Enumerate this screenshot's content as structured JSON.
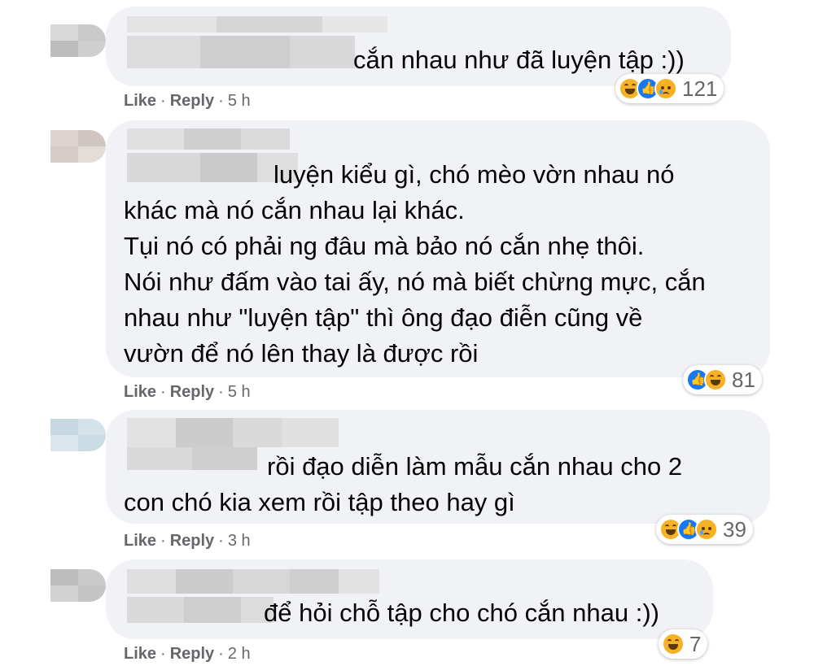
{
  "comments": [
    {
      "text": "cắn nhau như đã luyện tập :))",
      "reactions": {
        "icons": [
          "haha-icon",
          "like-icon",
          "sad-icon"
        ],
        "count": "121"
      },
      "like_label": "Like",
      "reply_label": "Reply",
      "time": "5 h"
    },
    {
      "text": "luyện kiểu gì, chó mèo vờn nhau nó\nkhác mà nó cắn nhau lại khác.\nTụi nó có phải ng đâu mà bảo nó cắn nhẹ thôi.\nNói như đấm vào tai ấy, nó mà biết chừng mực, cắn\nnhau như \"luyện tập\" thì ông đạo điễn cũng về\nvườn để nó lên thay là được rồi",
      "reactions": {
        "icons": [
          "like-icon",
          "haha-icon"
        ],
        "count": "81"
      },
      "like_label": "Like",
      "reply_label": "Reply",
      "time": "5 h"
    },
    {
      "text": "rồi đạo diễn làm mẫu cắn nhau cho 2\ncon chó kia xem rồi tập theo hay gì",
      "reactions": {
        "icons": [
          "haha-icon",
          "like-icon",
          "sad-icon"
        ],
        "count": "39"
      },
      "like_label": "Like",
      "reply_label": "Reply",
      "time": "3 h"
    },
    {
      "text": "để hỏi chỗ tập cho chó cắn nhau :))",
      "reactions": {
        "icons": [
          "haha-icon"
        ],
        "count": "7"
      },
      "like_label": "Like",
      "reply_label": "Reply",
      "time": "2 h"
    }
  ],
  "separator": "·",
  "colors": {
    "bubble": "#f0f2f5",
    "text": "#050505",
    "meta": "#65676b",
    "like_blue": "#1877f2",
    "haha_yellow": "#f7b125"
  }
}
